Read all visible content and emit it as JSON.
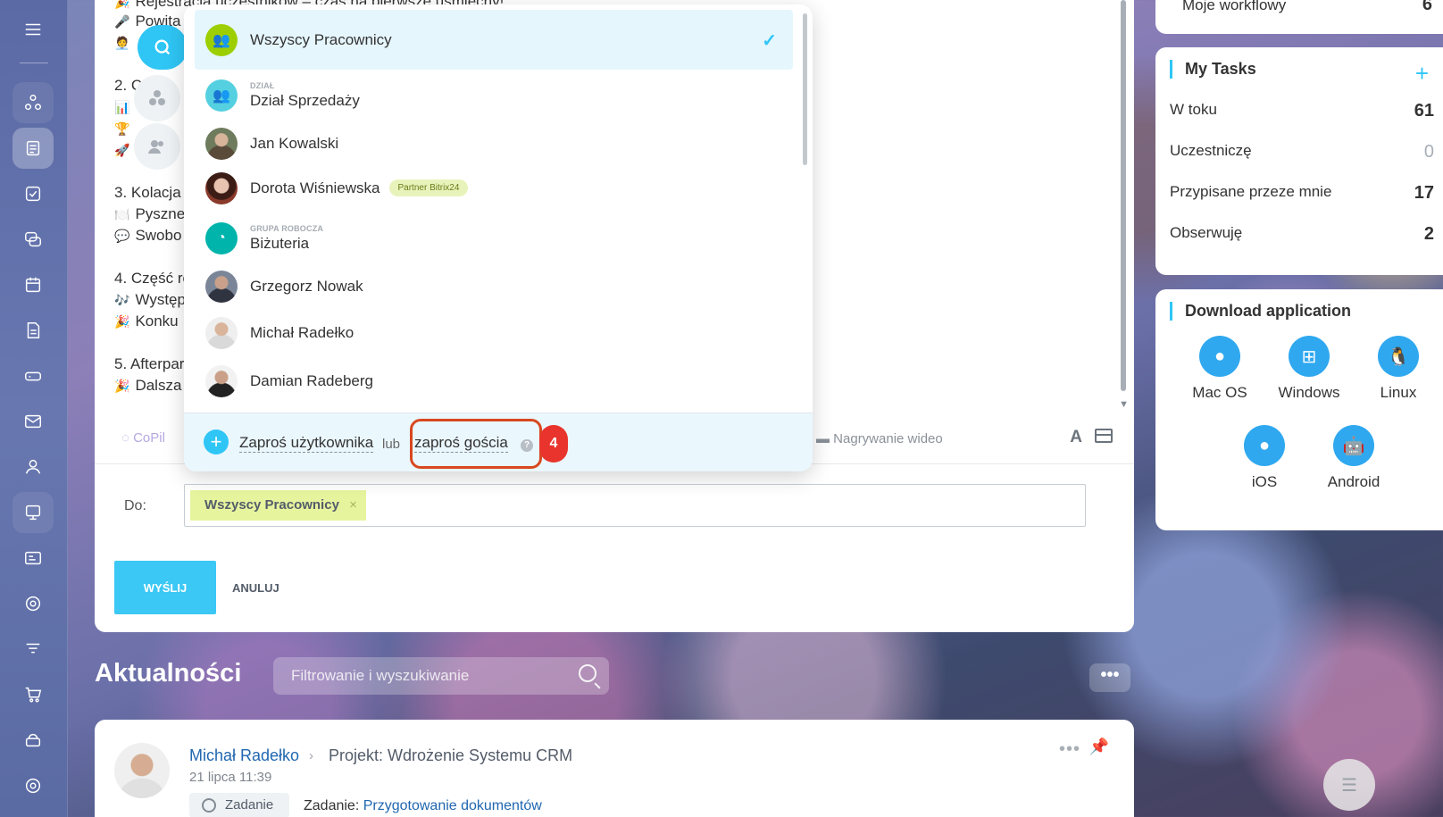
{
  "composer": {
    "lines": [
      {
        "icon": "🎉",
        "text": "Rejestracja uczestników – czas na pierwsze uśmiechy!"
      },
      {
        "icon": "🎤",
        "text": "Powita"
      },
      {
        "icon": "🧑‍💼",
        "text": ""
      },
      {
        "icon": "",
        "text": "2. C"
      },
      {
        "icon": "📊",
        "text": ""
      },
      {
        "icon": "🏆",
        "text": ""
      },
      {
        "icon": "🚀",
        "text": ""
      },
      {
        "icon": "",
        "text": "3. Kolacja"
      },
      {
        "icon": "🍽️",
        "text": "Pyszne"
      },
      {
        "icon": "💬",
        "text": "Swobo"
      },
      {
        "icon": "",
        "text": "4. Część ro"
      },
      {
        "icon": "🎶",
        "text": "Występ"
      },
      {
        "icon": "🎉",
        "text": "Konku"
      },
      {
        "icon": "",
        "text": "5. Afterpar"
      },
      {
        "icon": "🎉",
        "text": "Dalsza"
      }
    ],
    "copilot_label": "CoPil",
    "video_label": "Nagrywanie wideo",
    "format_label": "A",
    "to_label": "Do:",
    "to_chip": "Wszyscy Pracownicy",
    "to_chip_remove": "×",
    "send_label": "WYŚLIJ",
    "cancel_label": "ANULUJ"
  },
  "popup": {
    "items": [
      {
        "name": "Wszyscy Pracownicy",
        "category": "",
        "badge": "",
        "selected": true
      },
      {
        "name": "Dział Sprzedaży",
        "category": "DZIAŁ",
        "badge": "",
        "selected": false
      },
      {
        "name": "Jan Kowalski",
        "category": "",
        "badge": "",
        "selected": false
      },
      {
        "name": "Dorota Wiśniewska",
        "category": "",
        "badge": "Partner Bitrix24",
        "selected": false
      },
      {
        "name": "Biżuteria",
        "category": "GRUPA ROBOCZA",
        "badge": "",
        "selected": false
      },
      {
        "name": "Grzegorz Nowak",
        "category": "",
        "badge": "",
        "selected": false
      },
      {
        "name": "Michał Radełko",
        "category": "",
        "badge": "",
        "selected": false
      },
      {
        "name": "Damian Radeberg",
        "category": "",
        "badge": "",
        "selected": false
      }
    ],
    "invite_user": "Zaproś użytkownika",
    "or_label": "lub",
    "invite_guest": "zaproś gościa",
    "help": "?",
    "step_number": "4"
  },
  "widgets": {
    "workflows_label": "Moje workflowy",
    "workflows_count": "6",
    "tasks": {
      "title": "My Tasks",
      "add": "+",
      "rows": [
        {
          "label": "W toku",
          "count": "61",
          "zero": false
        },
        {
          "label": "Uczestniczę",
          "count": "0",
          "zero": true
        },
        {
          "label": "Przypisane przeze mnie",
          "count": "17",
          "zero": false
        },
        {
          "label": "Obserwuję",
          "count": "2",
          "zero": false
        }
      ]
    },
    "download": {
      "title": "Download application",
      "apps": [
        {
          "label": "Mac OS",
          "icon": "apple-icon"
        },
        {
          "label": "Windows",
          "icon": "windows-icon"
        },
        {
          "label": "Linux",
          "icon": "linux-icon"
        },
        {
          "label": "iOS",
          "icon": "apple-icon"
        },
        {
          "label": "Android",
          "icon": "android-icon"
        }
      ]
    }
  },
  "feed": {
    "title": "Aktualności",
    "search_placeholder": "Filtrowanie i wyszukiwanie",
    "more": "•••",
    "post": {
      "author": "Michał Radełko",
      "destination": "Projekt: Wdrożenie Systemu CRM",
      "date": "21 lipca 11:39",
      "tag": "Zadanie",
      "task_prefix": "Zadanie:",
      "task_link": "Przygotowanie dokumentów"
    }
  },
  "colors": {
    "accent": "#2fc6f6",
    "send_button": "#3bc8f5",
    "highlight": "#d8481f",
    "step_badge": "#e8342c",
    "chip": "#e7f49e",
    "selected_row": "#e5f6fd",
    "link": "#2067b0"
  }
}
